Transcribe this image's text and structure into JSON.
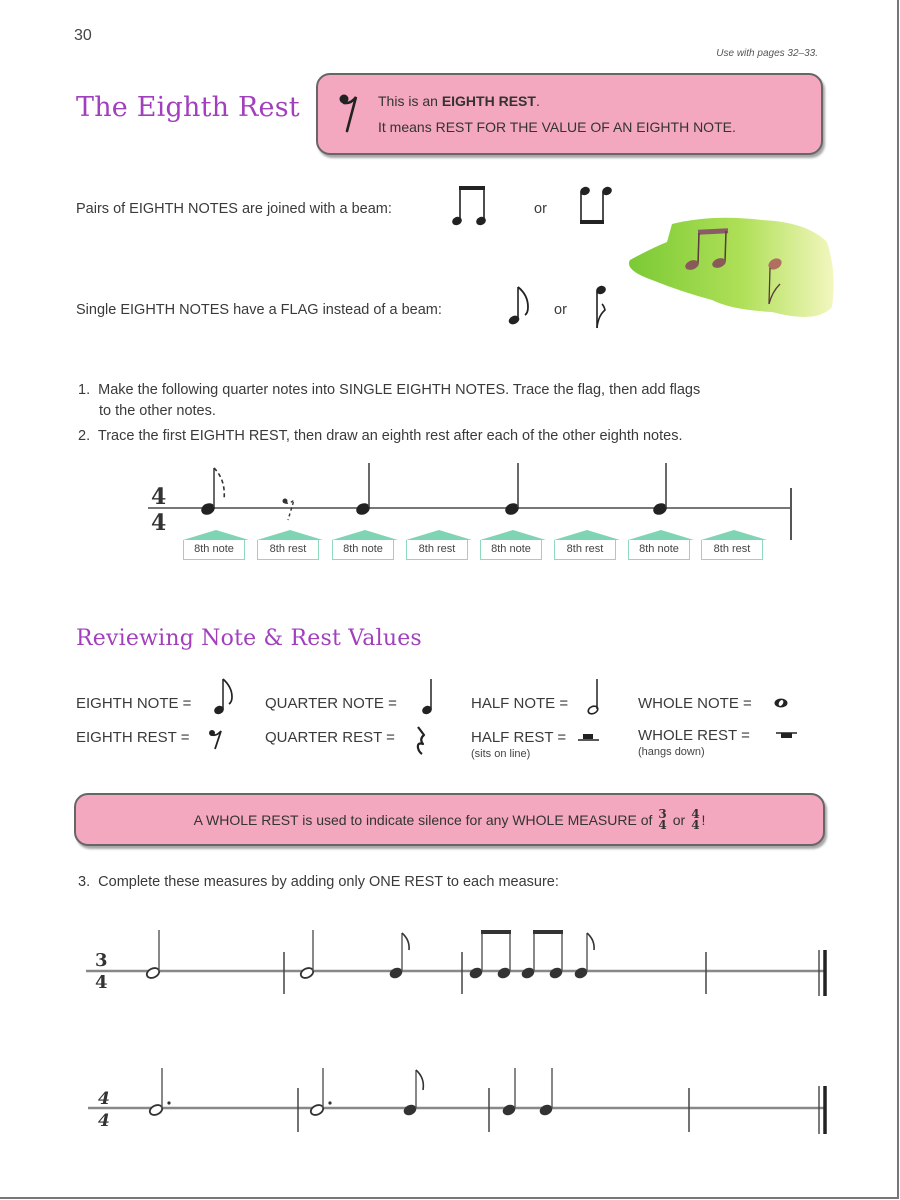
{
  "page": {
    "number": "30",
    "use_with": "Use with pages 32–33."
  },
  "section1": {
    "title": "The Eighth Rest",
    "info_box": {
      "line1_prefix": "This is an ",
      "line1_bold": "EIGHTH REST",
      "line1_suffix": ".",
      "line2": "It means REST FOR THE VALUE OF AN EIGHTH NOTE.",
      "icon": "eighth-rest-icon"
    },
    "beam_sentence": "Pairs of EIGHTH NOTES are joined with a beam:",
    "flag_sentence": "Single EIGHTH NOTES have a FLAG instead of a beam:",
    "or_label": "or",
    "decoration": "watercolor-music-notes"
  },
  "instructions": [
    {
      "num": "1.",
      "text": "Make the following quarter notes into SINGLE EIGHTH NOTES.  Trace the flag, then add flags",
      "cont": "to the other notes."
    },
    {
      "num": "2.",
      "text": "Trace the first EIGHTH REST, then draw an eighth rest after each of the other eighth notes."
    }
  ],
  "exercise1": {
    "time_signature": {
      "top": "4",
      "bottom": "4"
    },
    "labels": [
      "8th note",
      "8th rest",
      "8th note",
      "8th rest",
      "8th note",
      "8th rest",
      "8th note",
      "8th rest"
    ]
  },
  "section2": {
    "title": "Reviewing Note & Rest Values",
    "values": [
      {
        "label": "EIGHTH NOTE =",
        "symbol": "eighth-note-icon"
      },
      {
        "label": "QUARTER NOTE =",
        "symbol": "quarter-note-icon"
      },
      {
        "label": "HALF NOTE =",
        "symbol": "half-note-icon"
      },
      {
        "label": "WHOLE NOTE =",
        "symbol": "whole-note-icon"
      },
      {
        "label": "EIGHTH REST =",
        "symbol": "eighth-rest-icon"
      },
      {
        "label": "QUARTER REST =",
        "symbol": "quarter-rest-icon"
      },
      {
        "label": "HALF REST =",
        "symbol": "half-rest-icon",
        "note": "(sits on line)"
      },
      {
        "label": "WHOLE REST =",
        "symbol": "whole-rest-icon",
        "note": "(hangs down)"
      }
    ],
    "whole_rest_box": {
      "text": "A WHOLE REST is used to indicate silence for any WHOLE MEASURE of",
      "frac1": {
        "top": "3",
        "bottom": "4"
      },
      "or_label": "or",
      "frac2": {
        "top": "4",
        "bottom": "4"
      },
      "end": "!"
    }
  },
  "instruction3": {
    "num": "3.",
    "text": "Complete these measures by adding only ONE REST to each measure:"
  },
  "exercise3": {
    "staff1_time": {
      "top": "3",
      "bottom": "4"
    },
    "staff2_time": {
      "top": "4",
      "bottom": "4"
    }
  },
  "colors": {
    "heading": "#a13fbd",
    "pink_box": "#f3a8bf",
    "label_green": "#7fd4b3",
    "watercolor_green": "#8fd43a"
  }
}
